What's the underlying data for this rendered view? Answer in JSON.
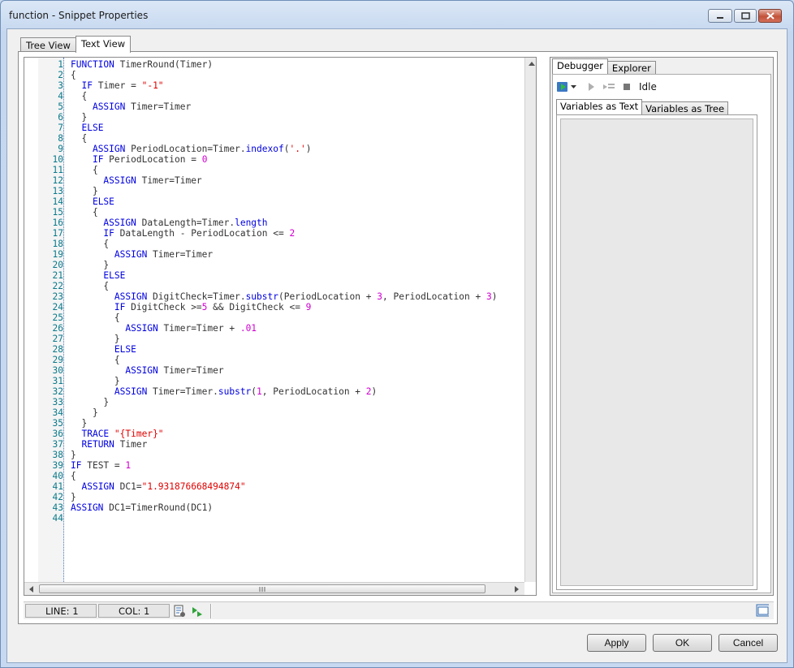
{
  "window": {
    "title": "function - Snippet Properties"
  },
  "main_tabs": [
    {
      "label": "Tree View"
    },
    {
      "label": "Text View"
    }
  ],
  "code_lines": [
    [
      [
        "kw",
        "FUNCTION"
      ],
      [
        "t",
        " TimerRound(Timer)"
      ]
    ],
    [
      [
        "t",
        "{"
      ]
    ],
    [
      [
        "t",
        "  "
      ],
      [
        "kw",
        "IF"
      ],
      [
        "t",
        " Timer = "
      ],
      [
        "str",
        "\"-1\""
      ]
    ],
    [
      [
        "t",
        "  {"
      ]
    ],
    [
      [
        "t",
        "    "
      ],
      [
        "kw",
        "ASSIGN"
      ],
      [
        "t",
        " Timer=Timer"
      ]
    ],
    [
      [
        "t",
        "  }"
      ]
    ],
    [
      [
        "t",
        "  "
      ],
      [
        "kw",
        "ELSE"
      ]
    ],
    [
      [
        "t",
        "  {"
      ]
    ],
    [
      [
        "t",
        "    "
      ],
      [
        "kw",
        "ASSIGN"
      ],
      [
        "t",
        " PeriodLocation=Timer."
      ],
      [
        "fn",
        "indexof"
      ],
      [
        "t",
        "("
      ],
      [
        "str",
        "'.'"
      ],
      [
        "t",
        ")"
      ]
    ],
    [
      [
        "t",
        "    "
      ],
      [
        "kw",
        "IF"
      ],
      [
        "t",
        " PeriodLocation = "
      ],
      [
        "num",
        "0"
      ]
    ],
    [
      [
        "t",
        "    {"
      ]
    ],
    [
      [
        "t",
        "      "
      ],
      [
        "kw",
        "ASSIGN"
      ],
      [
        "t",
        " Timer=Timer"
      ]
    ],
    [
      [
        "t",
        "    }"
      ]
    ],
    [
      [
        "t",
        "    "
      ],
      [
        "kw",
        "ELSE"
      ]
    ],
    [
      [
        "t",
        "    {"
      ]
    ],
    [
      [
        "t",
        "      "
      ],
      [
        "kw",
        "ASSIGN"
      ],
      [
        "t",
        " DataLength=Timer."
      ],
      [
        "fn",
        "length"
      ]
    ],
    [
      [
        "t",
        "      "
      ],
      [
        "kw",
        "IF"
      ],
      [
        "t",
        " DataLength - PeriodLocation <= "
      ],
      [
        "num",
        "2"
      ]
    ],
    [
      [
        "t",
        "      {"
      ]
    ],
    [
      [
        "t",
        "        "
      ],
      [
        "kw",
        "ASSIGN"
      ],
      [
        "t",
        " Timer=Timer"
      ]
    ],
    [
      [
        "t",
        "      }"
      ]
    ],
    [
      [
        "t",
        "      "
      ],
      [
        "kw",
        "ELSE"
      ]
    ],
    [
      [
        "t",
        "      {"
      ]
    ],
    [
      [
        "t",
        "        "
      ],
      [
        "kw",
        "ASSIGN"
      ],
      [
        "t",
        " DigitCheck=Timer."
      ],
      [
        "fn",
        "substr"
      ],
      [
        "t",
        "(PeriodLocation + "
      ],
      [
        "num",
        "3"
      ],
      [
        "t",
        ", PeriodLocation + "
      ],
      [
        "num",
        "3"
      ],
      [
        "t",
        ")"
      ]
    ],
    [
      [
        "t",
        "        "
      ],
      [
        "kw",
        "IF"
      ],
      [
        "t",
        " DigitCheck >="
      ],
      [
        "num",
        "5"
      ],
      [
        "t",
        " && DigitCheck <= "
      ],
      [
        "num",
        "9"
      ]
    ],
    [
      [
        "t",
        "        {"
      ]
    ],
    [
      [
        "t",
        "          "
      ],
      [
        "kw",
        "ASSIGN"
      ],
      [
        "t",
        " Timer=Timer + "
      ],
      [
        "num",
        ".01"
      ]
    ],
    [
      [
        "t",
        "        }"
      ]
    ],
    [
      [
        "t",
        "        "
      ],
      [
        "kw",
        "ELSE"
      ]
    ],
    [
      [
        "t",
        "        {"
      ]
    ],
    [
      [
        "t",
        "          "
      ],
      [
        "kw",
        "ASSIGN"
      ],
      [
        "t",
        " Timer=Timer"
      ]
    ],
    [
      [
        "t",
        "        }"
      ]
    ],
    [
      [
        "t",
        "        "
      ],
      [
        "kw",
        "ASSIGN"
      ],
      [
        "t",
        " Timer=Timer."
      ],
      [
        "fn",
        "substr"
      ],
      [
        "t",
        "("
      ],
      [
        "num",
        "1"
      ],
      [
        "t",
        ", PeriodLocation + "
      ],
      [
        "num",
        "2"
      ],
      [
        "t",
        ")"
      ]
    ],
    [
      [
        "t",
        "      }"
      ]
    ],
    [
      [
        "t",
        "    }"
      ]
    ],
    [
      [
        "t",
        "  }"
      ]
    ],
    [
      [
        "t",
        "  "
      ],
      [
        "kw",
        "TRACE"
      ],
      [
        "t",
        " "
      ],
      [
        "str",
        "\"{Timer}\""
      ]
    ],
    [
      [
        "t",
        "  "
      ],
      [
        "kw",
        "RETURN"
      ],
      [
        "t",
        " Timer"
      ]
    ],
    [
      [
        "t",
        "}"
      ]
    ],
    [
      [
        "kw",
        "IF"
      ],
      [
        "t",
        " TEST = "
      ],
      [
        "num",
        "1"
      ]
    ],
    [
      [
        "t",
        "{"
      ]
    ],
    [
      [
        "t",
        "  "
      ],
      [
        "kw",
        "ASSIGN"
      ],
      [
        "t",
        " DC1="
      ],
      [
        "str",
        "\"1.931876668494874\""
      ]
    ],
    [
      [
        "t",
        "}"
      ]
    ],
    [
      [
        "kw",
        "ASSIGN"
      ],
      [
        "t",
        " DC1=TimerRound(DC1)"
      ]
    ],
    []
  ],
  "debugger": {
    "tabs": [
      {
        "label": "Debugger"
      },
      {
        "label": "Explorer"
      }
    ],
    "status": "Idle",
    "subtabs": [
      {
        "label": "Variables as Text"
      },
      {
        "label": "Variables as Tree"
      }
    ]
  },
  "statusbar": {
    "line": "LINE: 1",
    "col": "COL: 1"
  },
  "buttons": {
    "apply": "Apply",
    "ok": "OK",
    "cancel": "Cancel"
  },
  "colors": {
    "keyword": "#0000e0",
    "string": "#e00000",
    "number": "#d000d0",
    "line_number": "#0a7a8a"
  },
  "icons": [
    "minimize-icon",
    "maximize-icon",
    "close-icon",
    "run-debug-icon",
    "dropdown-arrow-icon",
    "step-icon",
    "step-into-icon",
    "stop-icon",
    "script-icon",
    "run-script-icon",
    "panel-toggle-icon",
    "scroll-arrow-icon"
  ]
}
